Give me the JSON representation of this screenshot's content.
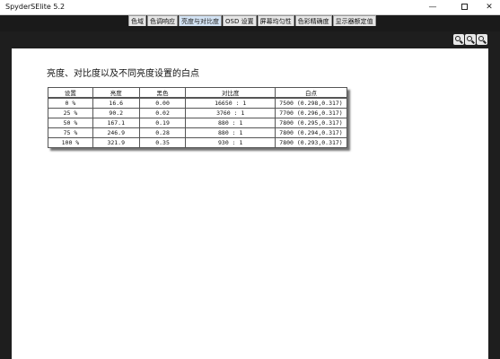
{
  "window": {
    "title": "SpyderSElite 5.2",
    "minimize_label": "—",
    "close_label": "✕"
  },
  "tabs": [
    {
      "label": "色域",
      "active": false
    },
    {
      "label": "色调响应",
      "active": false
    },
    {
      "label": "亮度与对比度",
      "active": true
    },
    {
      "label": "OSD 设置",
      "active": false
    },
    {
      "label": "屏幕均匀性",
      "active": false
    },
    {
      "label": "色彩精确度",
      "active": false
    },
    {
      "label": "显示器额定值",
      "active": false
    }
  ],
  "toolbar": {
    "icons": [
      "zoom-in-icon",
      "zoom-out-icon",
      "zoom-fit-icon"
    ]
  },
  "report": {
    "heading": "亮度、对比度以及不同亮度设置的白点",
    "table": {
      "headers": [
        "设置",
        "亮度",
        "黑色",
        "对比度",
        "白点"
      ],
      "rows": [
        [
          "0 %",
          "16.6",
          "0.00",
          "16650 : 1",
          "7500 (0.298,0.317)"
        ],
        [
          "25 %",
          "90.2",
          "0.02",
          "3760 : 1",
          "7700 (0.296,0.317)"
        ],
        [
          "50 %",
          "167.1",
          "0.19",
          "880 : 1",
          "7800 (0.295,0.317)"
        ],
        [
          "75 %",
          "246.9",
          "0.28",
          "880 : 1",
          "7800 (0.294,0.317)"
        ],
        [
          "100 %",
          "321.9",
          "0.35",
          "930 : 1",
          "7800 (0.293,0.317)"
        ]
      ]
    }
  }
}
